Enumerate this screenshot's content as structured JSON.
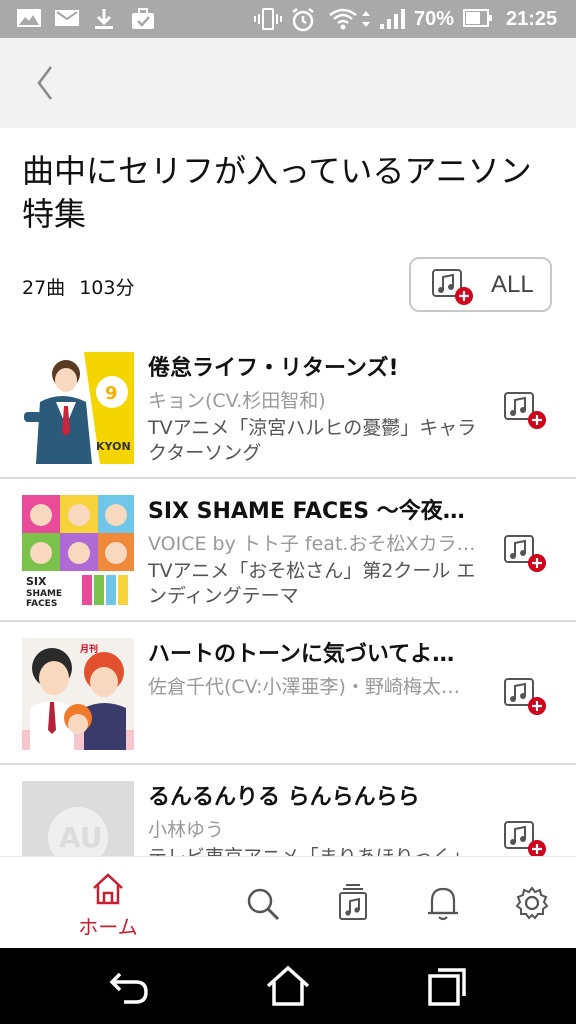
{
  "status_bar": {
    "battery": "70%",
    "time": "21:25"
  },
  "header": {
    "back_icon": "chevron-left-icon"
  },
  "playlist": {
    "title": "曲中にセリフが入っているアニソン特集",
    "track_count": "27曲",
    "duration": "103分",
    "all_button_label": "ALL"
  },
  "tracks": [
    {
      "title": "倦怠ライフ・リターンズ!",
      "artist": "キョン(CV.杉田智和)",
      "description": "TVアニメ「涼宮ハルヒの憂鬱」キャラクターソング"
    },
    {
      "title": "SIX SHAME FACES ～今夜も…",
      "artist": "VOICE by トト子 feat.おそ松Xカラ…",
      "description": "TVアニメ「おそ松さん」第2クール エンディングテーマ"
    },
    {
      "title": "ハートのトーンに気づいてよ…",
      "artist": "佐倉千代(CV:小澤亜李)・野崎梅太…",
      "description": ""
    },
    {
      "title": "るんるんりる らんらんらら",
      "artist": "小林ゆう",
      "description": "テレビ東京アニメ「まりあほりっく」"
    }
  ],
  "bottom_nav": {
    "home_label": "ホーム",
    "items": [
      "home-icon",
      "search-icon",
      "library-icon",
      "bell-icon",
      "gear-icon"
    ]
  },
  "colors": {
    "accent": "#c62033",
    "status_bar": "#a9a9a9",
    "header_bg": "#f2f2f2"
  }
}
